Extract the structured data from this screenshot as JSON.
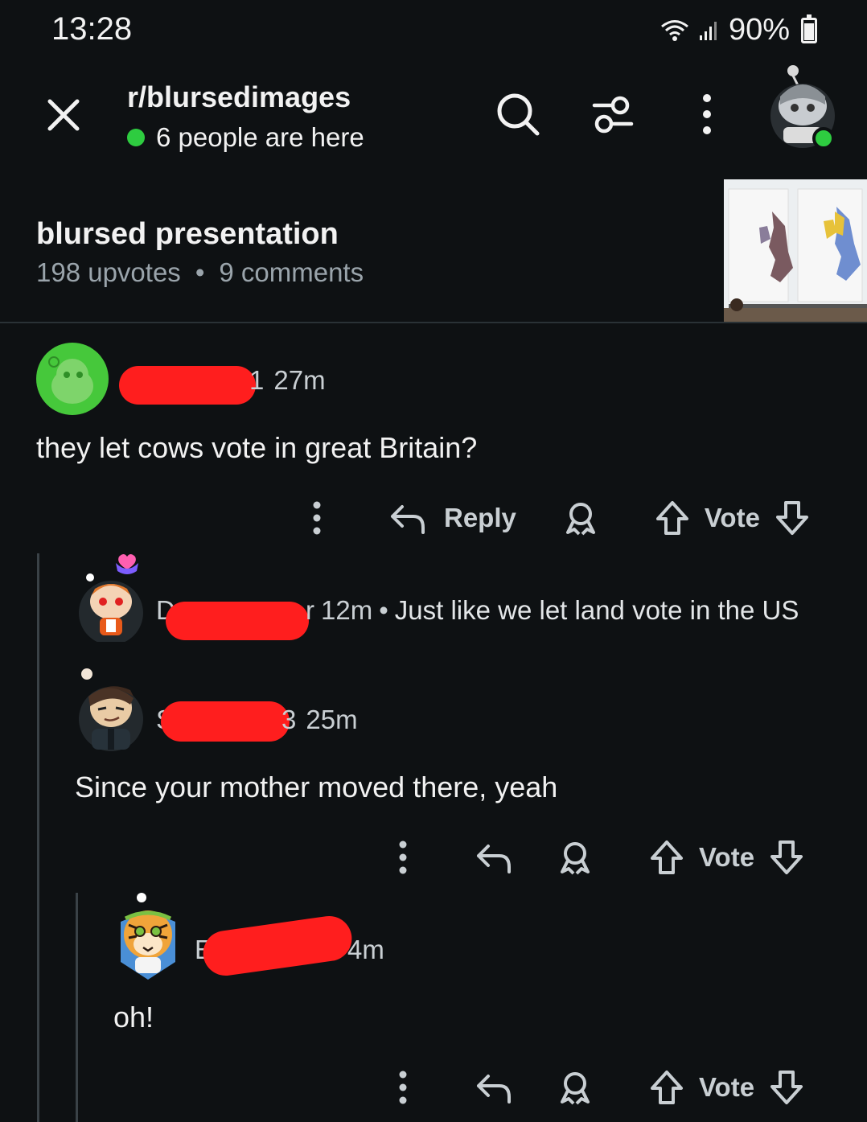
{
  "status_bar": {
    "time": "13:28",
    "battery": "90%",
    "icons": [
      "wifi-icon",
      "signal-icon",
      "battery-icon"
    ]
  },
  "header": {
    "subreddit": "r/blursedimages",
    "online": "6 people are here",
    "icons": [
      "close-icon",
      "search-icon",
      "filter-icon",
      "more-vertical-icon"
    ]
  },
  "post": {
    "title": "blursed presentation",
    "upvotes": "198 upvotes",
    "separator": "•",
    "comments": "9 comments"
  },
  "comments": [
    {
      "username_tail": "1",
      "time": "27m",
      "text": "they let cows vote in great Britain?"
    },
    {
      "username_head": "D",
      "username_tail": "r",
      "time": "12m",
      "separator": "•",
      "text": "Just like we let land vote in the US"
    },
    {
      "username_head": "S",
      "username_tail": "3",
      "time": "25m",
      "text": "Since your mother moved there, yeah"
    },
    {
      "username_head": "E",
      "time": "4m",
      "text": "oh!"
    }
  ],
  "actions": {
    "reply": "Reply",
    "vote": "Vote"
  },
  "colors": {
    "background": "#0e1113",
    "online": "#2ecc40",
    "redaction": "#ff1e1e",
    "muted": "#9aa4ab"
  }
}
